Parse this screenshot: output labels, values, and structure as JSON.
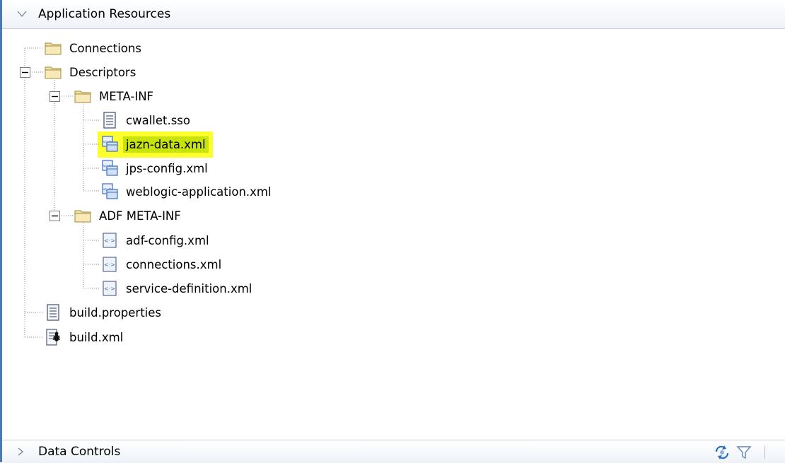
{
  "panel": {
    "title": "Application Resources",
    "collapse_icon": "chevron-down-icon"
  },
  "tree": {
    "connections": "Connections",
    "descriptors": "Descriptors",
    "meta_inf": "META-INF",
    "cwallet": "cwallet.sso",
    "jazn": "jazn-data.xml",
    "jps": "jps-config.xml",
    "weblogic": "weblogic-application.xml",
    "adf_meta_inf": "ADF META-INF",
    "adf_config": "adf-config.xml",
    "connections_xml": "connections.xml",
    "service_def": "service-definition.xml",
    "build_props": "build.properties",
    "build_xml": "build.xml"
  },
  "footer": {
    "title": "Data Controls",
    "expand_icon": "chevron-right-icon",
    "refresh_icon": "refresh-icon",
    "filter_icon": "filter-icon"
  },
  "colors": {
    "selection_highlight": "#fdff2c",
    "selection_label": "#c9e40a",
    "left_border": "#4a78b8"
  }
}
